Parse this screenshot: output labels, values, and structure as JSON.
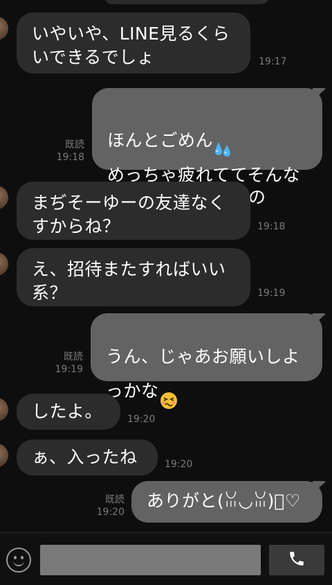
{
  "messages": [
    {
      "side": "in",
      "text": "いやいや、LINE見るくら\nいできるでしょ",
      "time": "19:17"
    },
    {
      "side": "out",
      "line1": "ほんとごめん",
      "emoji1": "sweat-drops",
      "line2": "めっちゃ疲れててそんな\n気も起きなかったの",
      "read": "既読",
      "time": "19:18"
    },
    {
      "side": "in",
      "text": "まぢそーゆーの友達なく\nすからね？",
      "time": "19:18"
    },
    {
      "side": "in",
      "text": "え、招待またすればいい\n系？",
      "time": "19:19"
    },
    {
      "side": "out",
      "line1": "うん、じゃあお願いしよ\nっかな",
      "emoji1": "persevering-face",
      "read": "既読",
      "time": "19:19"
    },
    {
      "side": "in",
      "text": "したよ。",
      "time": "19:20"
    },
    {
      "side": "in",
      "text": "ぁ、入ったね",
      "time": "19:20"
    },
    {
      "side": "out",
      "text": "ありがと(ꈍ◡ꈍ)ﾞ♡",
      "read": "既読",
      "time": "19:20"
    }
  ],
  "input": {
    "placeholder": "",
    "value": ""
  },
  "icons": {
    "emoji": "smiley-icon",
    "call": "phone-icon"
  },
  "colors": {
    "incoming_bubble": "#2c2c2c",
    "outgoing_bubble": "#636363",
    "background": "#0e0e0e",
    "meta_text": "#7a7a7a"
  }
}
